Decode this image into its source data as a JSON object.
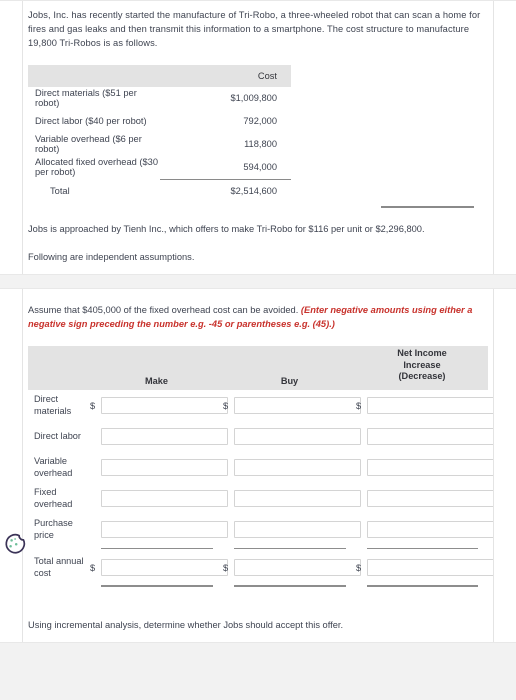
{
  "problem": {
    "intro": "Jobs, Inc. has recently started the manufacture of Tri-Robo, a three-wheeled robot that can scan a home for fires and gas leaks and then transmit this information to a smartphone. The cost structure to manufacture 19,800 Tri-Robos is as follows.",
    "offer": "Jobs is approached by Tienh Inc., which offers to make Tri-Robo for $116 per unit or $2,296,800.",
    "assumptions_note": "Following are independent assumptions.",
    "closing": "Using incremental analysis, determine whether Jobs should accept this offer."
  },
  "cost_table": {
    "header": "Cost",
    "rows": [
      {
        "label": "Direct materials ($51 per robot)",
        "value": "$1,009,800"
      },
      {
        "label": "Direct labor ($40 per robot)",
        "value": "792,000"
      },
      {
        "label": "Variable overhead ($6 per robot)",
        "value": "118,800"
      },
      {
        "label": "Allocated fixed overhead ($30 per robot)",
        "value": "594,000"
      }
    ],
    "total_label": "Total",
    "total_value": "$2,514,600"
  },
  "assumption": {
    "text": "Assume that $405,000 of the fixed overhead cost can be avoided.",
    "instruction": "(Enter negative amounts using either a negative sign preceding the number e.g. -45 or parentheses e.g. (45).)"
  },
  "form": {
    "columns": {
      "blank": "",
      "make": "Make",
      "buy": "Buy",
      "net_income_line1": "Net Income",
      "net_income_line2": "Increase",
      "net_income_line3": "(Decrease)"
    },
    "dollar_sign": "$",
    "rows": [
      {
        "label": "Direct materials",
        "make": "",
        "buy": "",
        "net": "",
        "show_dollar": true
      },
      {
        "label": "Direct labor",
        "make": "",
        "buy": "",
        "net": "",
        "show_dollar": false
      },
      {
        "label": "Variable overhead",
        "make": "",
        "buy": "",
        "net": "",
        "show_dollar": false
      },
      {
        "label": "Fixed overhead",
        "make": "",
        "buy": "",
        "net": "",
        "show_dollar": false
      },
      {
        "label": "Purchase price",
        "make": "",
        "buy": "",
        "net": "",
        "show_dollar": false
      },
      {
        "label": "Total annual cost",
        "make": "",
        "buy": "",
        "net": "",
        "show_dollar": true
      }
    ]
  },
  "cookie": {
    "icon": "cookie-icon",
    "outline_color": "#3b3357",
    "chip_color": "#6fbf9a"
  }
}
